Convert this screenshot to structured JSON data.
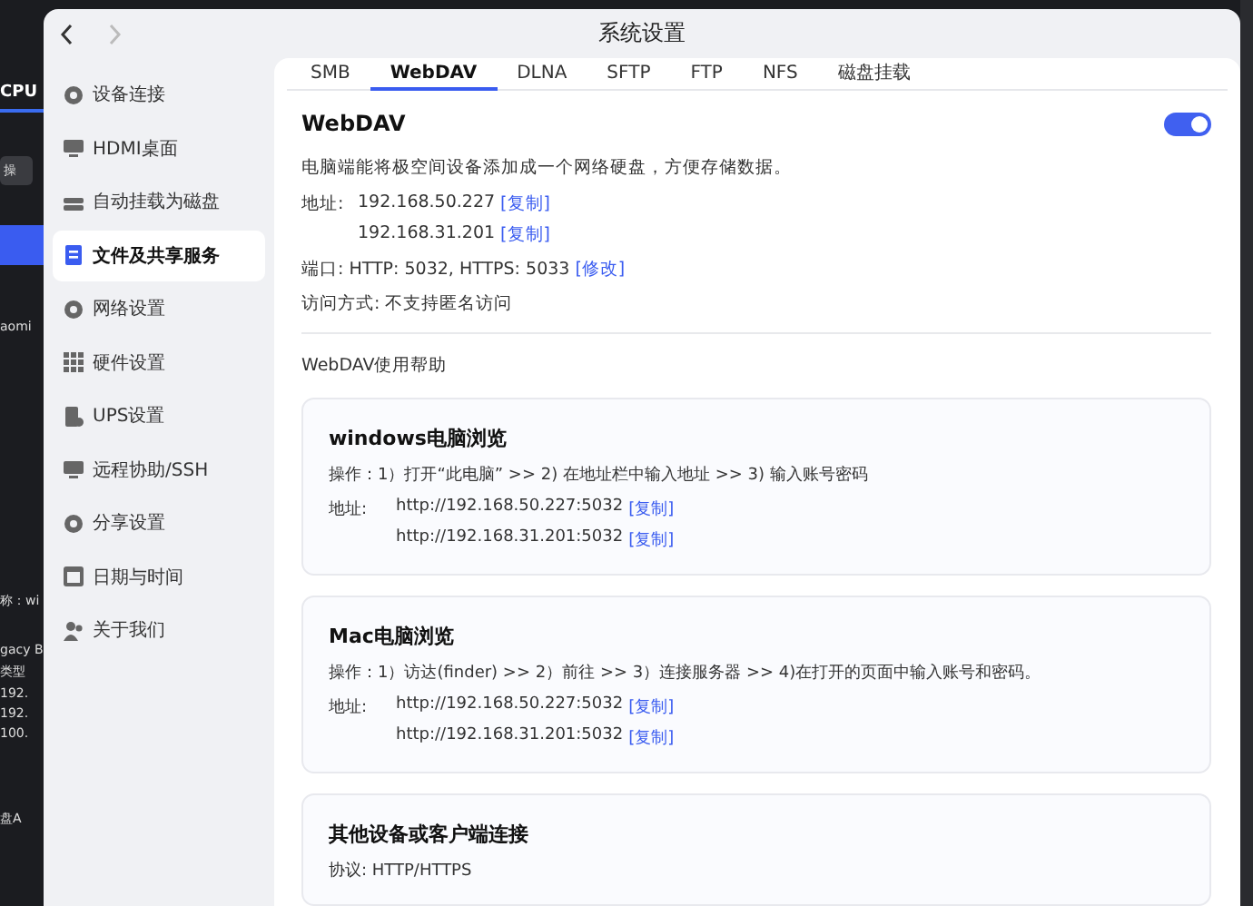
{
  "background_app": {
    "fragments": [
      {
        "kind": "heading",
        "text": "CPU"
      },
      {
        "kind": "button",
        "text": "操"
      },
      {
        "kind": "highlight"
      },
      {
        "kind": "text",
        "text": "aomi"
      },
      {
        "kind": "text",
        "text": "称：wi"
      },
      {
        "kind": "text",
        "text": "gacy B"
      },
      {
        "kind": "text",
        "text": "类型"
      },
      {
        "kind": "text",
        "text": "192."
      },
      {
        "kind": "text",
        "text": "192."
      },
      {
        "kind": "text",
        "text": "100."
      },
      {
        "kind": "text",
        "text": "盘A"
      }
    ]
  },
  "window": {
    "title": "系统设置"
  },
  "sidebar": {
    "items": [
      {
        "label": "设备连接",
        "selected": false
      },
      {
        "label": "HDMI桌面",
        "selected": false
      },
      {
        "label": "自动挂载为磁盘",
        "selected": false
      },
      {
        "label": "文件及共享服务",
        "selected": true
      },
      {
        "label": "网络设置",
        "selected": false
      },
      {
        "label": "硬件设置",
        "selected": false
      },
      {
        "label": "UPS设置",
        "selected": false
      },
      {
        "label": "远程协助/SSH",
        "selected": false
      },
      {
        "label": "分享设置",
        "selected": false
      },
      {
        "label": "日期与时间",
        "selected": false
      },
      {
        "label": "关于我们",
        "selected": false
      }
    ]
  },
  "tabs": [
    {
      "label": "SMB",
      "selected": false
    },
    {
      "label": "WebDAV",
      "selected": true
    },
    {
      "label": "DLNA",
      "selected": false
    },
    {
      "label": "SFTP",
      "selected": false
    },
    {
      "label": "FTP",
      "selected": false
    },
    {
      "label": "NFS",
      "selected": false
    },
    {
      "label": "磁盘挂载",
      "selected": false
    }
  ],
  "section": {
    "title": "WebDAV",
    "on": true,
    "description": "电脑端能将极空间设备添加成一个网络硬盘，方便存储数据。",
    "address_label": "地址:",
    "addresses": [
      {
        "value": "192.168.50.227",
        "copy": "[复制]"
      },
      {
        "value": "192.168.31.201",
        "copy": "[复制]"
      }
    ],
    "port": "端口: HTTP: 5032, HTTPS: 5033",
    "port_edit": "[修改]",
    "access": "访问方式: 不支持匿名访问"
  },
  "help_title": "WebDAV使用帮助",
  "help_cards": [
    {
      "title": "windows电脑浏览",
      "steps": "操作：1）打开“此电脑” >> 2) 在地址栏中输入地址 >> 3) 输入账号密码",
      "address_label": "地址:",
      "addresses": [
        {
          "value": "http://192.168.50.227:5032",
          "copy": "[复制]"
        },
        {
          "value": "http://192.168.31.201:5032",
          "copy": "[复制]"
        }
      ]
    },
    {
      "title": "Mac电脑浏览",
      "steps": "操作：1）访达(finder) >> 2）前往 >> 3）连接服务器 >> 4)在打开的页面中输入账号和密码。",
      "address_label": "地址:",
      "addresses": [
        {
          "value": "http://192.168.50.227:5032",
          "copy": "[复制]"
        },
        {
          "value": "http://192.168.31.201:5032",
          "copy": "[复制]"
        }
      ]
    },
    {
      "title": "其他设备或客户端连接",
      "steps": "协议: HTTP/HTTPS"
    }
  ]
}
